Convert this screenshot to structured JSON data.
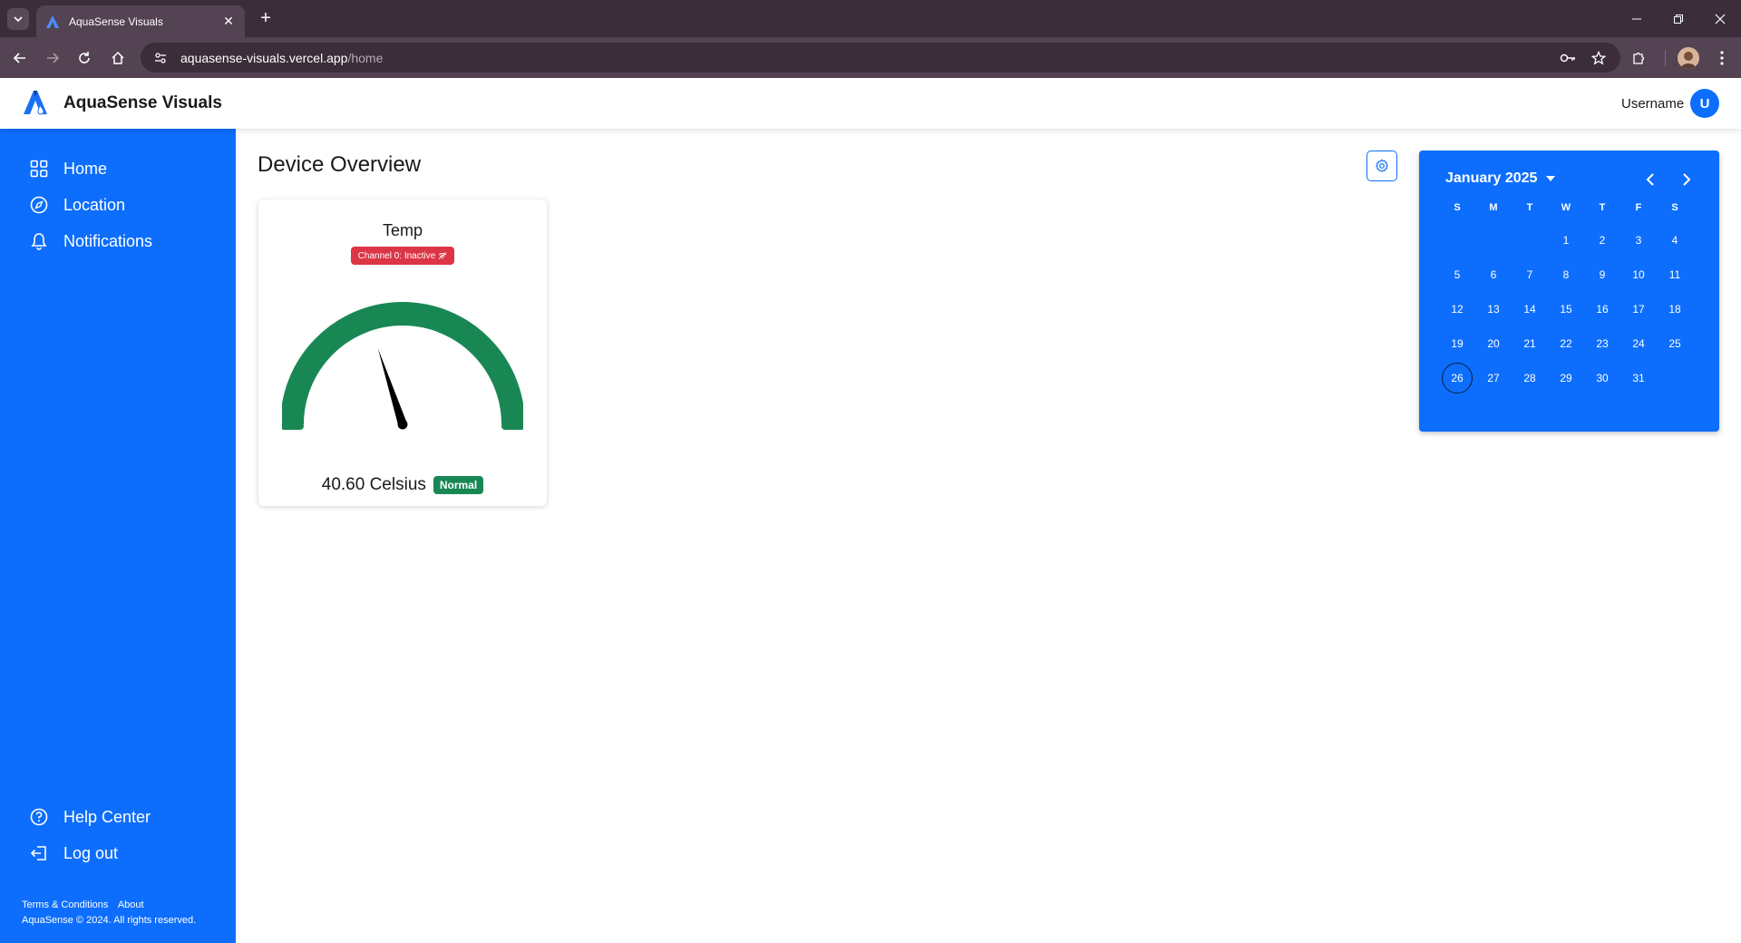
{
  "browser": {
    "tab_title": "AquaSense Visuals",
    "url_host": "aquasense-visuals.vercel.app",
    "url_path": "/home"
  },
  "header": {
    "brand": "AquaSense Visuals",
    "username": "Username",
    "avatar_initial": "U"
  },
  "sidebar": {
    "items": [
      {
        "label": "Home",
        "icon": "grid-icon"
      },
      {
        "label": "Location",
        "icon": "compass-icon"
      },
      {
        "label": "Notifications",
        "icon": "bell-icon"
      }
    ],
    "bottom_items": [
      {
        "label": "Help Center",
        "icon": "help-circle-icon"
      },
      {
        "label": "Log out",
        "icon": "logout-icon"
      }
    ],
    "footer_links": [
      "Terms & Conditions",
      "About"
    ],
    "copyright": "AquaSense © 2024. All rights reserved."
  },
  "main": {
    "title": "Device Overview",
    "devices": [
      {
        "name": "Temp",
        "channel_badge": "Channel 0: Inactive",
        "reading": "40.60 Celsius",
        "status": "Normal",
        "gauge_value_fraction": 0.4
      }
    ]
  },
  "calendar": {
    "month_label": "January 2025",
    "weekdays": [
      "S",
      "M",
      "T",
      "W",
      "T",
      "F",
      "S"
    ],
    "weeks": [
      [
        "",
        "",
        "",
        "1",
        "2",
        "3",
        "4"
      ],
      [
        "5",
        "6",
        "7",
        "8",
        "9",
        "10",
        "11"
      ],
      [
        "12",
        "13",
        "14",
        "15",
        "16",
        "17",
        "18"
      ],
      [
        "19",
        "20",
        "21",
        "22",
        "23",
        "24",
        "25"
      ],
      [
        "26",
        "27",
        "28",
        "29",
        "30",
        "31",
        ""
      ]
    ],
    "selected_day": "26"
  },
  "colors": {
    "primary": "#0d6efd",
    "danger": "#dc3545",
    "success": "#198754",
    "gauge": "#198754"
  }
}
